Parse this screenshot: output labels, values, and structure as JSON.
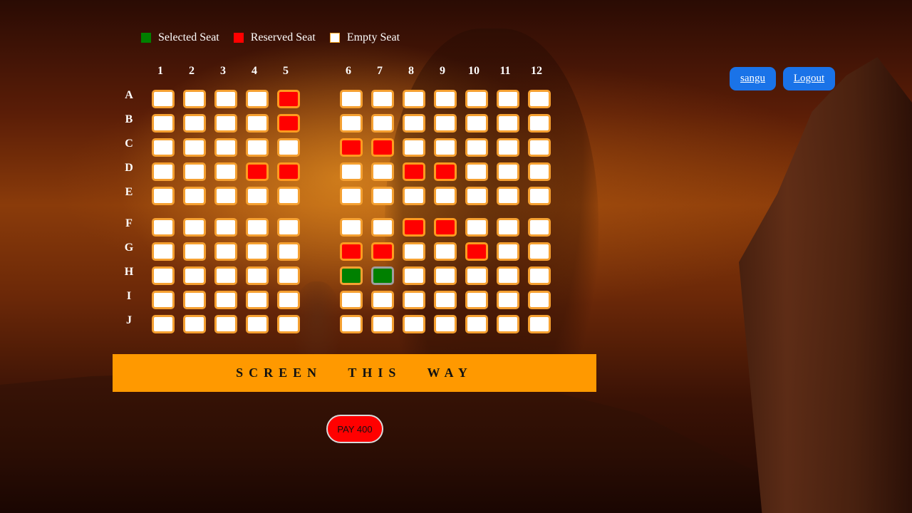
{
  "legend": {
    "selected_label": "Selected Seat",
    "reserved_label": "Reserved Seat",
    "empty_label": "Empty Seat"
  },
  "colors": {
    "selected": "#008000",
    "reserved": "#ff0000",
    "empty": "#ffffff",
    "seat_border": "#f5a031",
    "screen": "#ff9900",
    "nav_button": "#1a73e8",
    "pay_button": "#ff0000"
  },
  "columns": [
    "1",
    "2",
    "3",
    "4",
    "5",
    "6",
    "7",
    "8",
    "9",
    "10",
    "11",
    "12"
  ],
  "rows": [
    {
      "label": "A",
      "seats": [
        "empty",
        "empty",
        "empty",
        "empty",
        "reserved",
        "empty",
        "empty",
        "empty",
        "empty",
        "empty",
        "empty",
        "empty"
      ]
    },
    {
      "label": "B",
      "seats": [
        "empty",
        "empty",
        "empty",
        "empty",
        "reserved",
        "empty",
        "empty",
        "empty",
        "empty",
        "empty",
        "empty",
        "empty"
      ]
    },
    {
      "label": "C",
      "seats": [
        "empty",
        "empty",
        "empty",
        "empty",
        "empty",
        "reserved",
        "reserved",
        "empty",
        "empty",
        "empty",
        "empty",
        "empty"
      ]
    },
    {
      "label": "D",
      "seats": [
        "empty",
        "empty",
        "empty",
        "reserved",
        "reserved",
        "empty",
        "empty",
        "reserved",
        "reserved",
        "empty",
        "empty",
        "empty"
      ]
    },
    {
      "label": "E",
      "seats": [
        "empty",
        "empty",
        "empty",
        "empty",
        "empty",
        "empty",
        "empty",
        "empty",
        "empty",
        "empty",
        "empty",
        "empty"
      ]
    },
    {
      "label": "F",
      "seats": [
        "empty",
        "empty",
        "empty",
        "empty",
        "empty",
        "empty",
        "empty",
        "reserved",
        "reserved",
        "empty",
        "empty",
        "empty"
      ]
    },
    {
      "label": "G",
      "seats": [
        "empty",
        "empty",
        "empty",
        "empty",
        "empty",
        "reserved",
        "reserved",
        "empty",
        "empty",
        "reserved",
        "empty",
        "empty"
      ]
    },
    {
      "label": "H",
      "seats": [
        "empty",
        "empty",
        "empty",
        "empty",
        "empty",
        "selected",
        "selected",
        "empty",
        "empty",
        "empty",
        "empty",
        "empty"
      ]
    },
    {
      "label": "I",
      "seats": [
        "empty",
        "empty",
        "empty",
        "empty",
        "empty",
        "empty",
        "empty",
        "empty",
        "empty",
        "empty",
        "empty",
        "empty"
      ]
    },
    {
      "label": "J",
      "seats": [
        "empty",
        "empty",
        "empty",
        "empty",
        "empty",
        "empty",
        "empty",
        "empty",
        "empty",
        "empty",
        "empty",
        "empty"
      ]
    }
  ],
  "screen_label": "SCREEN THIS WAY",
  "pay_label": "PAY 400",
  "user": {
    "name": "sangu",
    "logout_label": "Logout"
  }
}
